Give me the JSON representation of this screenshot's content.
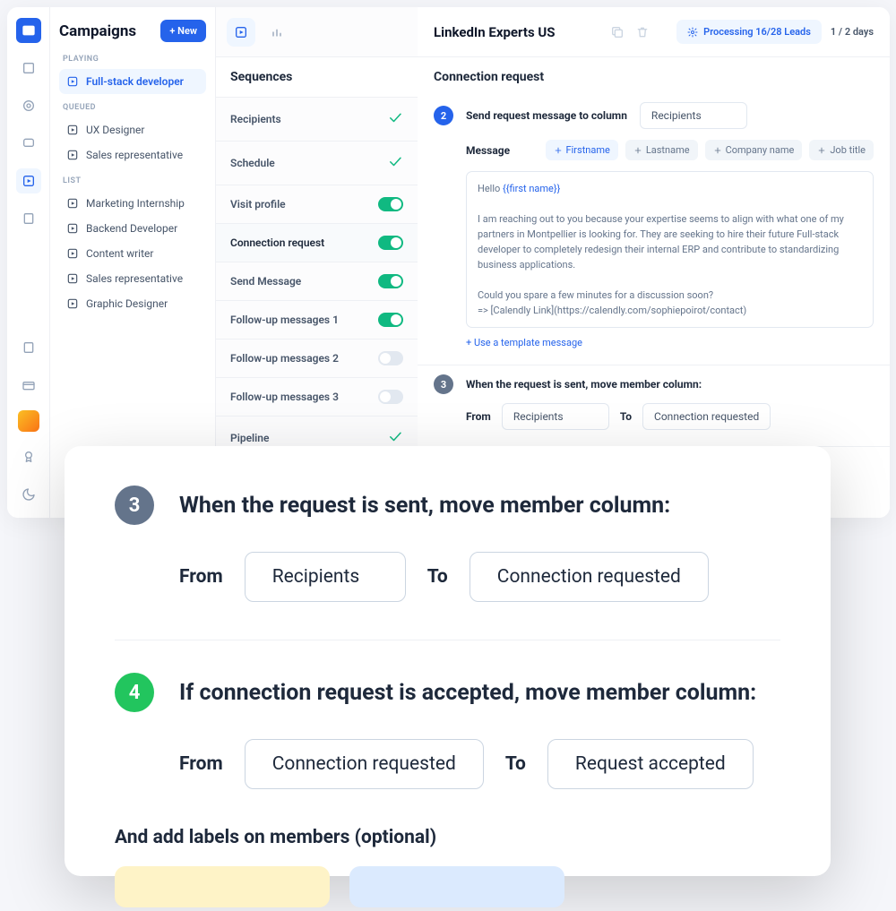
{
  "sidebar": {
    "title": "Campaigns",
    "new_label": "+ New",
    "sections": {
      "playing": "PLAYING",
      "queued": "QUEUED",
      "list": "LIST"
    },
    "active_item": "Full-stack developer",
    "queued_items": [
      "UX Designer",
      "Sales representative"
    ],
    "list_items": [
      "Marketing Internship",
      "Backend Developer",
      "Content writer",
      "Sales representative",
      "Graphic Designer"
    ]
  },
  "campaign": {
    "name": "LinkedIn Experts US",
    "status": "Processing 16/28 Leads",
    "days": "1 / 2 days"
  },
  "sequences": {
    "header": "Sequences",
    "items": [
      {
        "label": "Recipients",
        "state": "check"
      },
      {
        "label": "Schedule",
        "state": "check"
      },
      {
        "label": "Visit profile",
        "state": "on"
      },
      {
        "label": "Connection request",
        "state": "on",
        "selected": true
      },
      {
        "label": "Send Message",
        "state": "on"
      },
      {
        "label": "Follow-up messages 1",
        "state": "on"
      },
      {
        "label": "Follow-up messages 2",
        "state": "off"
      },
      {
        "label": "Follow-up messages 3",
        "state": "off"
      },
      {
        "label": "Pipeline",
        "state": "check"
      }
    ]
  },
  "panel": {
    "header": "Connection request",
    "step2": {
      "title": "Send request message to column",
      "column": "Recipients"
    },
    "message_label": "Message",
    "tokens": [
      "Firstname",
      "Lastname",
      "Company name",
      "Job title"
    ],
    "message_hello": "Hello ",
    "message_var": "{{first name}}",
    "message_body": "I am reaching out to you because your expertise seems to align with what one of my partners in Montpellier is looking for. They are seeking to hire their future Full-stack developer to completely redesign their internal ERP and contribute to standardizing business applications.",
    "message_cta": "Could you spare a few minutes for a discussion soon?\n=> [Calendly Link](https://calendly.com/sophiepoirot/contact)",
    "template_link": "+ Use a template message",
    "step3": {
      "title": "When the request is sent, move member column:",
      "from_label": "From",
      "from": "Recipients",
      "to_label": "To",
      "to": "Connection requested"
    },
    "step4": {
      "title": "If connection request is accepted, move member column:"
    }
  },
  "overlay": {
    "step3": {
      "title": "When the request is sent, move member column:",
      "from_label": "From",
      "from": "Recipients",
      "to_label": "To",
      "to": "Connection requested"
    },
    "step4": {
      "title": "If connection request is accepted, move member column:",
      "from_label": "From",
      "from": "Connection requested",
      "to_label": "To",
      "to": "Request accepted"
    },
    "labels_title": "And add labels on members (optional)"
  }
}
